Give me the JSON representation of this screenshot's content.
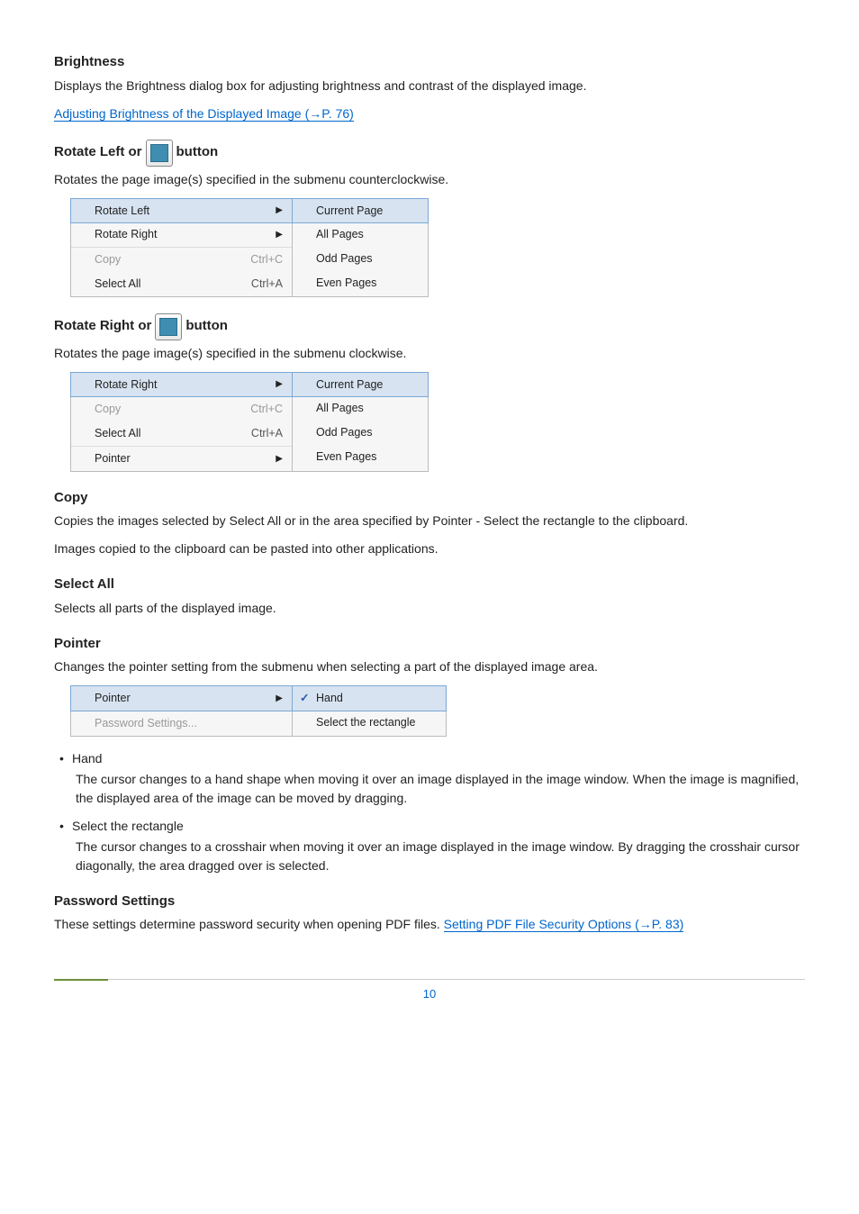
{
  "brightness": {
    "heading": "Brightness",
    "desc": "Displays the Brightness dialog box for adjusting brightness and contrast of the displayed image.",
    "link": "Adjusting Brightness of the Displayed Image (→P. 76)"
  },
  "rotateLeft": {
    "heading_pre": "Rotate Left or ",
    "heading_post": " button",
    "desc": "Rotates the page image(s) specified in the submenu counterclockwise.",
    "menuLeft": [
      {
        "label": "Rotate Left",
        "arrow": true,
        "highlight": true
      },
      {
        "label": "Rotate Right",
        "arrow": true
      },
      {
        "label": "Copy",
        "shortcut": "Ctrl+C",
        "disabled": true,
        "sepBefore": true
      },
      {
        "label": "Select All",
        "shortcut": "Ctrl+A"
      }
    ],
    "menuRight": [
      {
        "label": "Current Page",
        "highlight": true
      },
      {
        "label": "All Pages"
      },
      {
        "label": "Odd Pages"
      },
      {
        "label": "Even Pages"
      }
    ]
  },
  "rotateRight": {
    "heading_pre": "Rotate Right or ",
    "heading_post": " button",
    "desc": "Rotates the page image(s) specified in the submenu clockwise.",
    "menuLeft": [
      {
        "label": "Rotate Right",
        "arrow": true,
        "highlight": true
      },
      {
        "label": "Copy",
        "shortcut": "Ctrl+C",
        "disabled": true,
        "sepBefore": true
      },
      {
        "label": "Select All",
        "shortcut": "Ctrl+A"
      },
      {
        "label": "Pointer",
        "arrow": true,
        "sepBefore": true
      }
    ],
    "menuRight": [
      {
        "label": "Current Page",
        "highlight": true
      },
      {
        "label": "All Pages"
      },
      {
        "label": "Odd Pages"
      },
      {
        "label": "Even Pages"
      }
    ]
  },
  "copy": {
    "heading": "Copy",
    "desc1": "Copies the images selected by Select All or in the area specified by Pointer - Select the rectangle to the clipboard.",
    "desc2": "Images copied to the clipboard can be pasted into other applications."
  },
  "selectAll": {
    "heading": "Select All",
    "desc": "Selects all parts of the displayed image."
  },
  "pointer": {
    "heading": "Pointer",
    "desc": "Changes the pointer setting from the submenu when selecting a part of the displayed image area.",
    "menuLeft": [
      {
        "label": "Pointer",
        "arrow": true,
        "highlight": true
      },
      {
        "label": "Password Settings...",
        "disabled": true,
        "sepBefore": true
      }
    ],
    "menuRight": [
      {
        "label": "Hand",
        "highlight": true,
        "check": true
      },
      {
        "label": "Select the rectangle"
      }
    ],
    "bullets": [
      {
        "title": "Hand",
        "body": "The cursor changes to a hand shape when moving it over an image displayed in the image window. When the image is magnified, the displayed area of the image can be moved by dragging."
      },
      {
        "title": "Select the rectangle",
        "body": "The cursor changes to a crosshair when moving it over an image displayed in the image window. By dragging the crosshair cursor diagonally, the area dragged over is selected."
      }
    ]
  },
  "password": {
    "heading": "Password Settings",
    "desc_pre": "These settings determine password security when opening PDF files. ",
    "link": "Setting PDF File Security Options (→P. 83)"
  },
  "pageNumber": "10"
}
